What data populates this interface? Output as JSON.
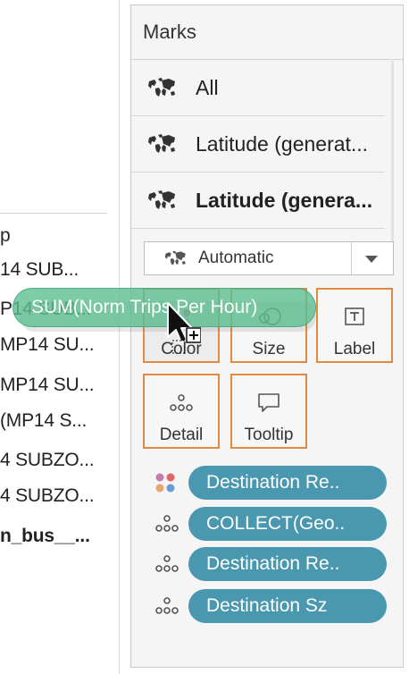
{
  "left_panel": {
    "rows": [
      {
        "text": "p",
        "bold": false
      },
      {
        "text": "14 SUB...",
        "bold": false
      },
      {
        "text": "P14 SUB...",
        "bold": false
      },
      {
        "text": "MP14 SU...",
        "bold": false
      },
      {
        "text": "MP14 SU...",
        "bold": false
      },
      {
        "text": "(MP14 S...",
        "bold": false
      },
      {
        "text": "4 SUBZO...",
        "bold": false
      },
      {
        "text": "4 SUBZO...",
        "bold": false
      },
      {
        "text": "n_bus__...",
        "bold": true
      }
    ]
  },
  "marks": {
    "title": "Marks",
    "layers": [
      {
        "label": "All",
        "icon": "map-icon",
        "bold": false
      },
      {
        "label": "Latitude (generat...",
        "icon": "map-icon",
        "bold": false
      },
      {
        "label": "Latitude (genera...",
        "icon": "map-icon",
        "bold": true
      }
    ],
    "mark_type": {
      "value": "Automatic",
      "icon": "map-icon"
    },
    "properties": [
      {
        "key": "color",
        "label": "Color",
        "icon": "color-icon"
      },
      {
        "key": "size",
        "label": "Size",
        "icon": "size-icon"
      },
      {
        "key": "label",
        "label": "Label",
        "icon": "label-icon"
      },
      {
        "key": "detail",
        "label": "Detail",
        "icon": "detail-icon"
      },
      {
        "key": "tooltip",
        "label": "Tooltip",
        "icon": "tooltip-icon"
      }
    ],
    "fields": [
      {
        "label": "Destination Re..",
        "icon": "color-icon"
      },
      {
        "label": "COLLECT(Geo..",
        "icon": "detail-icon"
      },
      {
        "label": "Destination Re..",
        "icon": "detail-icon"
      },
      {
        "label": "Destination Sz",
        "icon": "detail-icon"
      }
    ]
  },
  "drag": {
    "label": "SUM(Norm Trips Per Hour)"
  },
  "colors": {
    "pill": "#4a97b0",
    "drag_pill": "#5ebe91",
    "highlight_border": "#e08a43"
  }
}
